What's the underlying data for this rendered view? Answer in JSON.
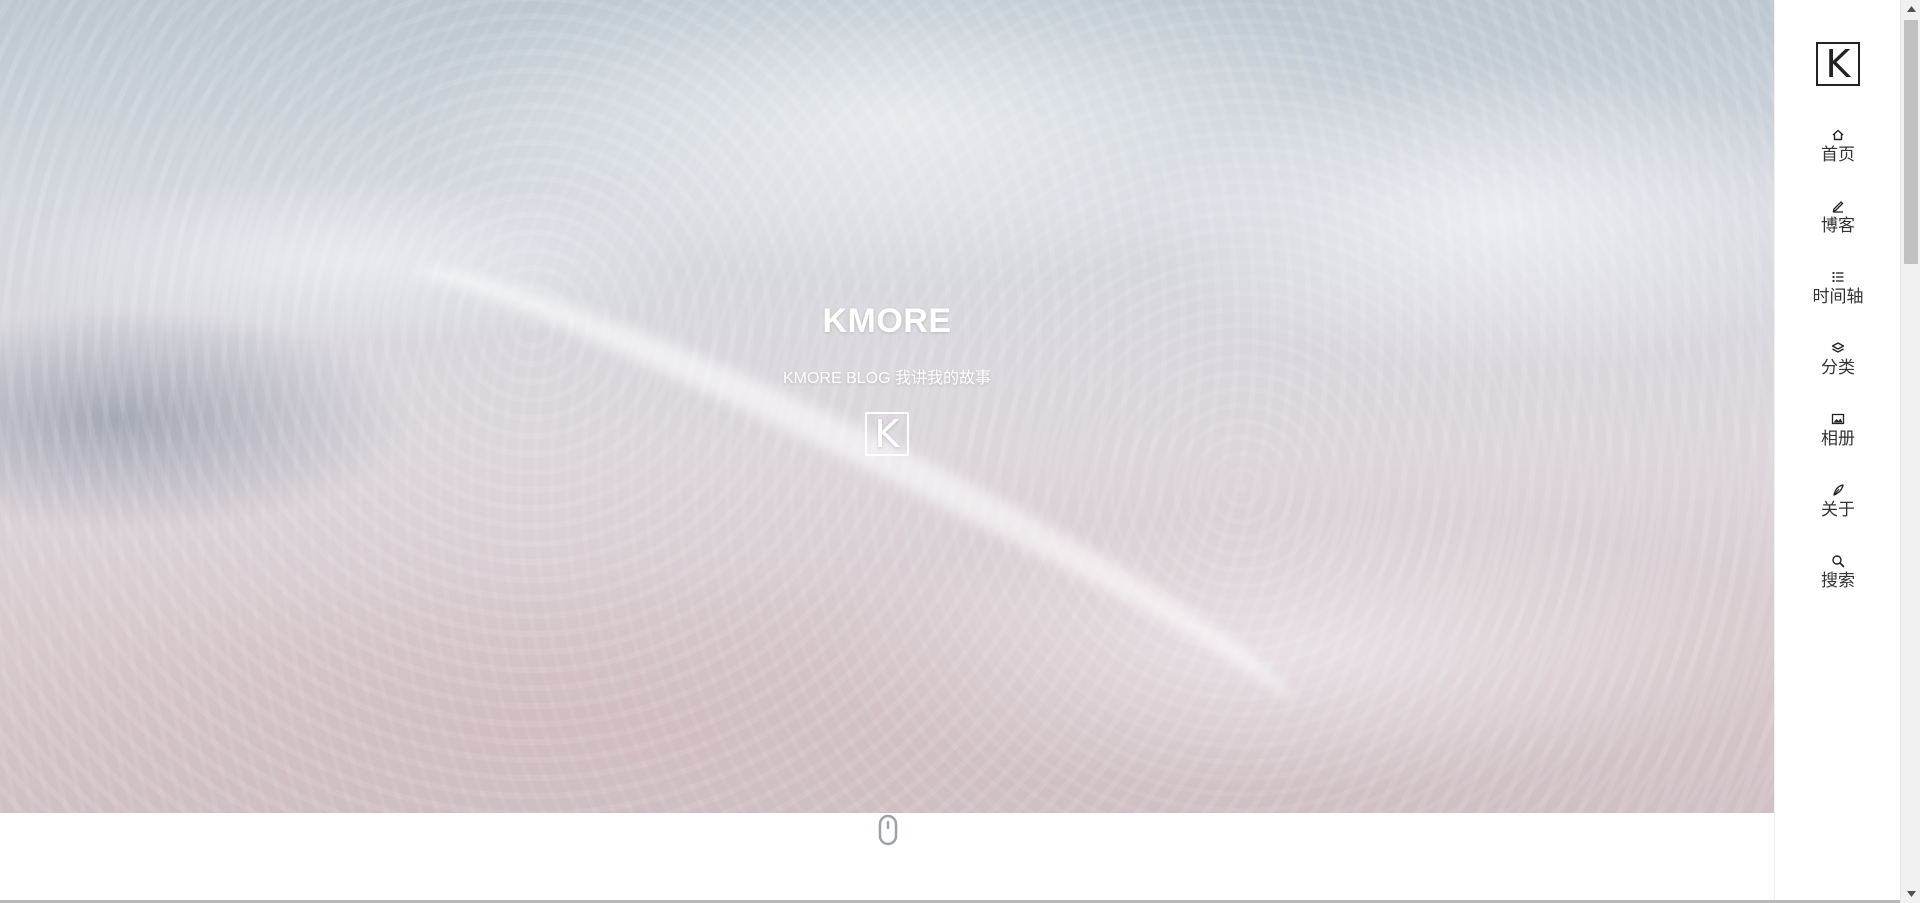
{
  "hero": {
    "title": "KMORE",
    "subtitle": "KMORE BLOG 我讲我的故事",
    "logo_letter": "K"
  },
  "sidebar": {
    "logo_letter": "K",
    "items": [
      {
        "label": "首页",
        "icon": "home-icon"
      },
      {
        "label": "博客",
        "icon": "pen-icon"
      },
      {
        "label": "时间轴",
        "icon": "list-icon"
      },
      {
        "label": "分类",
        "icon": "layers-icon"
      },
      {
        "label": "相册",
        "icon": "image-icon"
      },
      {
        "label": "关于",
        "icon": "feather-icon"
      },
      {
        "label": "搜索",
        "icon": "search-icon"
      }
    ]
  },
  "colors": {
    "text_dark": "#333333",
    "hero_text": "#ffffff",
    "scroll_thumb": "#c1c1c1"
  }
}
